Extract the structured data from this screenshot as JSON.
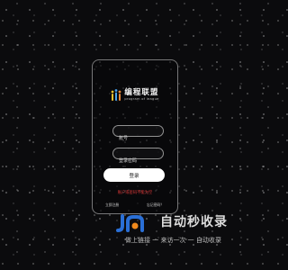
{
  "brand": {
    "title": "编程联盟",
    "subtitle": "program of league",
    "logo_icon": "people-icon"
  },
  "form": {
    "username_placeholder": "账号",
    "password_placeholder": "登录密码",
    "login_label": "登录",
    "error_message": "账户或密码不能为空"
  },
  "footer": {
    "register_link": "立即注册",
    "forgot_link": "忘记密码？"
  },
  "watermark": {
    "title": "自动秒收录",
    "subtitle": "做上链接 一 来访一次 一 自动收录"
  },
  "colors": {
    "background": "#0b0b0d",
    "card_border": "#8a8a8a",
    "button_bg": "#ffffff",
    "error": "#e03a3a",
    "watermark_blue": "#2a6fd6",
    "watermark_orange": "#f08a1c"
  }
}
